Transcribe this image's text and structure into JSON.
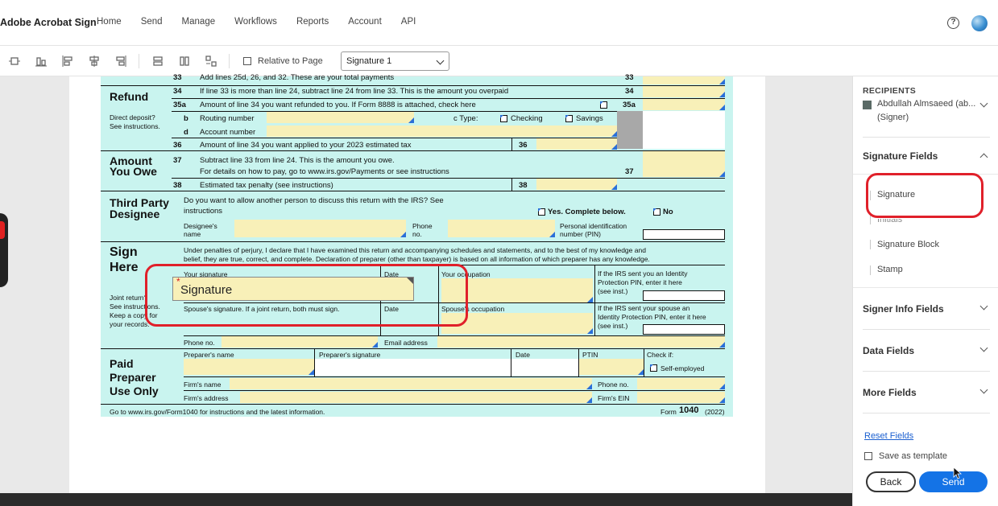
{
  "nav": {
    "brand": "Adobe Acrobat Sign",
    "items": [
      "Home",
      "Send",
      "Manage",
      "Workflows",
      "Reports",
      "Account",
      "API"
    ],
    "help_glyph": "?"
  },
  "toolbar": {
    "relative_label": "Relative to Page",
    "select_value": "Signature 1"
  },
  "form": {
    "l33": "33",
    "l33_text": "Add lines 25d, 26, and 32. These are your total payments",
    "refund": "Refund",
    "l34": "34",
    "l34_text": "If line 33 is more than line 24, subtract line 24 from line 33. This is the amount you overpaid",
    "l35a": "35a",
    "l35a_text": "Amount of line 34 you want refunded to you. If Form 8888 is attached, check here",
    "direct_deposit": "Direct deposit?",
    "see_instructions": "See instructions.",
    "lb": "b",
    "routing": "Routing number",
    "ctype": "c Type:",
    "checking": "Checking",
    "savings": "Savings",
    "ld": "d",
    "account": "Account number",
    "l36": "36",
    "l36_text": "Amount of line 34 you want applied to your 2023 estimated tax",
    "amount_you_owe_1": "Amount",
    "amount_you_owe_2": "You Owe",
    "l37": "37",
    "l37_text": "Subtract line 33 from line 24. This is the amount you owe.",
    "l37_text2": "For details on how to pay, go to www.irs.gov/Payments or see instructions",
    "l38": "38",
    "l38_text": "Estimated tax penalty (see instructions)",
    "third_party_1": "Third Party",
    "third_party_2": "Designee",
    "tp_question": "Do you want to allow another person to discuss this return with the IRS? See",
    "tp_question2": "instructions",
    "yes_complete": "Yes. Complete below.",
    "no": "No",
    "designee_name_1": "Designee's",
    "designee_name_2": "name",
    "phone_no_1": "Phone",
    "phone_no_2": "no.",
    "pin_1": "Personal identification",
    "pin_2": "number (PIN)",
    "sign_here_1": "Sign",
    "sign_here_2": "Here",
    "perjury_1": "Under penalties of perjury, I declare that I have examined this return and accompanying schedules and statements, and to the best of my knowledge and",
    "perjury_2": "belief, they are true, correct, and complete. Declaration of preparer (other than taxpayer) is based on all information of which preparer has any knowledge.",
    "your_signature": "Your signature",
    "date": "Date",
    "your_occupation": "Your occupation",
    "ip_pin_1": "If the IRS sent you an Identity",
    "ip_pin_2": "Protection PIN, enter it here",
    "ip_pin_3": "(see inst.)",
    "joint_1": "Joint return?",
    "joint_2": "See instructions.",
    "joint_3": "Keep a copy for",
    "joint_4": "your records.",
    "spouse_sig": "Spouse's signature. If a joint return, both must sign.",
    "spouse_occ": "Spouse's occupation",
    "sp_pin_1": "If the IRS sent your spouse an",
    "sp_pin_2": "Identity Protection PIN, enter it here",
    "sp_pin_3": "(see inst.)",
    "phone": "Phone no.",
    "email": "Email address",
    "paid_1": "Paid",
    "paid_2": "Preparer",
    "paid_3": "Use Only",
    "preparer_name": "Preparer's name",
    "preparer_sig": "Preparer's signature",
    "ptin": "PTIN",
    "check_if": "Check if:",
    "self_employed": "Self-employed",
    "firm_name": "Firm's name",
    "firm_phone": "Phone no.",
    "firm_address": "Firm's address",
    "firm_ein": "Firm's EIN",
    "footer_left": "Go to www.irs.gov/Form1040 for instructions and the latest information.",
    "footer_right_form": "Form",
    "footer_right_num": "1040",
    "footer_right_year": "(2022)"
  },
  "signature_field": {
    "required_mark": "*",
    "label": "Signature"
  },
  "panel": {
    "recipients_title": "RECIPIENTS",
    "recipient_name": "Abdullah Almsaeed (ab...",
    "recipient_role": "(Signer)",
    "signature_fields_title": "Signature Fields",
    "signature_field_items": [
      "Signature",
      "Initials",
      "Signature Block",
      "Stamp"
    ],
    "signer_info_title": "Signer Info Fields",
    "data_fields_title": "Data Fields",
    "more_fields_title": "More Fields",
    "reset_fields": "Reset Fields",
    "save_template": "Save as template",
    "back": "Back",
    "send": "Send"
  },
  "colors": {
    "accent": "#1473e6",
    "highlight": "#e0202a",
    "form_bg": "#c9f4ef",
    "field_bg": "#f8f0b8"
  }
}
